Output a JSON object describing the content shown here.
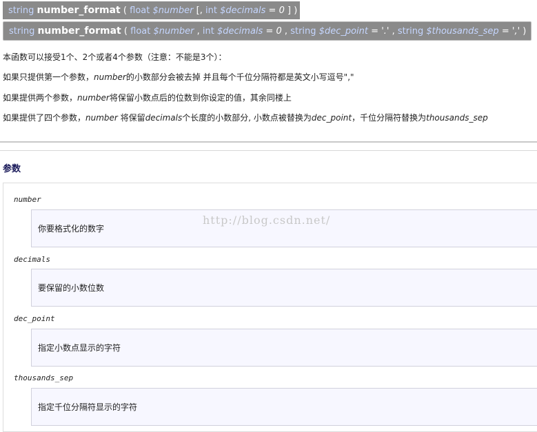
{
  "signature1": {
    "return_type": "string",
    "name": "number_format",
    "open": "(",
    "p1_type": "float",
    "p1_name": "$number",
    "opt_open": "[,",
    "p2_type": "int",
    "p2_name": "$decimals",
    "p2_eq": "=",
    "p2_default": "0",
    "close": "] )"
  },
  "signature2": {
    "return_type": "string",
    "name": "number_format",
    "open": "(",
    "p1_type": "float",
    "p1_name": "$number",
    "sep1": ",",
    "p2_type": "int",
    "p2_name": "$decimals",
    "p2_eq": "=",
    "p2_default": "0",
    "sep2": ",",
    "p3_type": "string",
    "p3_name": "$dec_point",
    "p3_eq": "=",
    "p3_default": "'.'",
    "sep3": ",",
    "p4_type": "string",
    "p4_name": "$thousands_sep",
    "p4_eq": "=",
    "p4_default": "','",
    "close": ")"
  },
  "description": {
    "line0": "本函数可以接受1个、2个或者4个参数（注意：不能是3个）：",
    "line1_a": "如果只提供第一个参数，",
    "line1_b": "number",
    "line1_c": "的小数部分会被去掉 并且每个千位分隔符都是英文小写逗号\",\"",
    "line2_a": "如果提供两个参数，",
    "line2_b": "number",
    "line2_c": "将保留小数点后的位数到你设定的值，其余同楼上",
    "line3_a": "如果提供了四个参数，",
    "line3_b": "number",
    "line3_c": " 将保留",
    "line3_d": "decimals",
    "line3_e": "个长度的小数部分, 小数点被替换为",
    "line3_f": "dec_point",
    "line3_g": "，千位分隔符替换为",
    "line3_h": "thousands_sep"
  },
  "params_heading": "参数",
  "params": [
    {
      "name": "number",
      "desc": "你要格式化的数字"
    },
    {
      "name": "decimals",
      "desc": "要保留的小数位数"
    },
    {
      "name": "dec_point",
      "desc": "指定小数点显示的字符"
    },
    {
      "name": "thousands_sep",
      "desc": "指定千位分隔符显示的字符"
    }
  ],
  "watermark": "http://blog.csdn.net/",
  "colors": {
    "signature_bg": "#8a8a8a",
    "type_color": "#c5d6ff",
    "param_box_bg": "#f7f7ff",
    "heading_color": "#1a1a5a"
  }
}
